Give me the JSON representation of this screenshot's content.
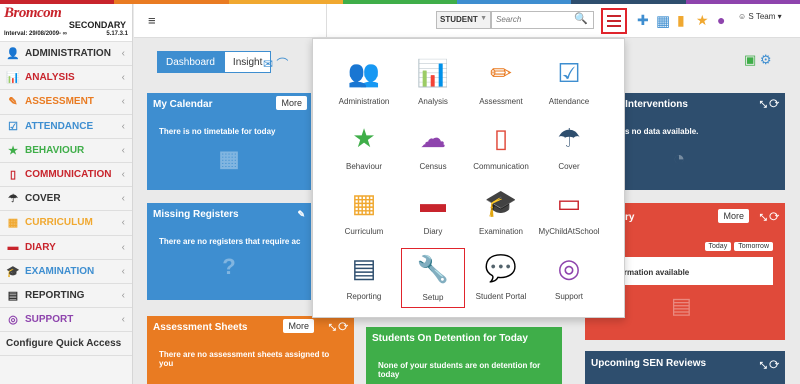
{
  "app": {
    "logo": "Bromcom",
    "subtitle": "SECONDARY",
    "interval": "Interval: 29/08/2009- ∞",
    "version": "5.17.3.1"
  },
  "sidebar": {
    "items": [
      {
        "label": "ADMINISTRATION",
        "icon": "person-icon",
        "color": "#333333",
        "glyph": "👤"
      },
      {
        "label": "ANALYSIS",
        "icon": "bar-chart-icon",
        "color": "#c8242c",
        "glyph": "📊"
      },
      {
        "label": "ASSESSMENT",
        "icon": "pencil-icon",
        "color": "#e97b22",
        "glyph": "✎"
      },
      {
        "label": "ATTENDANCE",
        "icon": "checkbox-icon",
        "color": "#3e8ed0",
        "glyph": "☑"
      },
      {
        "label": "BEHAVIOUR",
        "icon": "star-icon",
        "color": "#3fae49",
        "glyph": "★"
      },
      {
        "label": "COMMUNICATION",
        "icon": "phone-icon",
        "color": "#c8242c",
        "glyph": "▯"
      },
      {
        "label": "COVER",
        "icon": "umbrella-icon",
        "color": "#333333",
        "glyph": "☂"
      },
      {
        "label": "CURRICULUM",
        "icon": "calendar-icon",
        "color": "#f0a830",
        "glyph": "▦"
      },
      {
        "label": "DIARY",
        "icon": "book-icon",
        "color": "#c8242c",
        "glyph": "▬"
      },
      {
        "label": "EXAMINATION",
        "icon": "graduation-cap-icon",
        "color": "#3e8ed0",
        "glyph": "🎓"
      },
      {
        "label": "REPORTING",
        "icon": "document-icon",
        "color": "#333333",
        "glyph": "▤"
      },
      {
        "label": "SUPPORT",
        "icon": "lifebuoy-icon",
        "color": "#8e44ad",
        "glyph": "◎"
      },
      {
        "label": "Configure Quick Access",
        "icon": "",
        "color": "#333333",
        "glyph": ""
      }
    ]
  },
  "topbar": {
    "student_select": "STUDENT",
    "search_placeholder": "Search",
    "user": "S Team"
  },
  "tabs": [
    "Dashboard",
    "Insight"
  ],
  "widgets": {
    "calendar": {
      "title": "My Calendar",
      "more": "More",
      "body": "There is no timetable for today"
    },
    "registers": {
      "title": "Missing Registers",
      "body": "There are no registers that require ac"
    },
    "assessment": {
      "title": "Assessment Sheets",
      "more": "More",
      "body": "There are no assessment sheets assigned to you"
    },
    "detention": {
      "title": "Students On Detention for Today",
      "body": "None of your students are on detention for today"
    },
    "interventions": {
      "title": "t Interventions",
      "body": "s no data available."
    },
    "diary": {
      "title": "ry",
      "more": "More",
      "today": "Today",
      "tomorrow": "Tomorrow",
      "body": "ormation available"
    },
    "sen": {
      "title": "Upcoming SEN Reviews"
    }
  },
  "menu": {
    "tiles": [
      {
        "label": "Administration",
        "icon": "users-icon",
        "color": "#2e4e6e",
        "glyph": "👥"
      },
      {
        "label": "Analysis",
        "icon": "bar-chart-icon",
        "color": "#e04a3a",
        "glyph": "📊"
      },
      {
        "label": "Assessment",
        "icon": "pencil-icon",
        "color": "#e97b22",
        "glyph": "✏"
      },
      {
        "label": "Attendance",
        "icon": "checkbox-icon",
        "color": "#3e8ed0",
        "glyph": "☑"
      },
      {
        "label": "Behaviour",
        "icon": "star-icon",
        "color": "#3fae49",
        "glyph": "★"
      },
      {
        "label": "Census",
        "icon": "cloud-upload-icon",
        "color": "#8e44ad",
        "glyph": "☁"
      },
      {
        "label": "Communication",
        "icon": "mobile-icon",
        "color": "#e04a3a",
        "glyph": "▯"
      },
      {
        "label": "Cover",
        "icon": "umbrella-icon",
        "color": "#2e4e6e",
        "glyph": "☂"
      },
      {
        "label": "Curriculum",
        "icon": "calendar-icon",
        "color": "#f0a830",
        "glyph": "▦"
      },
      {
        "label": "Diary",
        "icon": "book-icon",
        "color": "#c8242c",
        "glyph": "▬"
      },
      {
        "label": "Examination",
        "icon": "graduation-cap-icon",
        "color": "#3e8ed0",
        "glyph": "🎓"
      },
      {
        "label": "MyChildAtSchool",
        "icon": "monitor-icon",
        "color": "#c8242c",
        "glyph": "▭"
      },
      {
        "label": "Reporting",
        "icon": "document-icon",
        "color": "#2e4e6e",
        "glyph": "▤"
      },
      {
        "label": "Setup",
        "icon": "wrench-icon",
        "color": "#3fae49",
        "glyph": "🔧"
      },
      {
        "label": "Student Portal",
        "icon": "chat-icon",
        "color": "#e97b22",
        "glyph": "💬"
      },
      {
        "label": "Support",
        "icon": "lifebuoy-icon",
        "color": "#8e44ad",
        "glyph": "◎"
      }
    ]
  },
  "colors": {
    "accent_blue": "#3e8ed0",
    "brand_red": "#c8242c",
    "stripe": [
      "#c8242c",
      "#e97b22",
      "#f0a830",
      "#3fae49",
      "#3e8ed0",
      "#2e4e6e",
      "#8e44ad"
    ]
  }
}
